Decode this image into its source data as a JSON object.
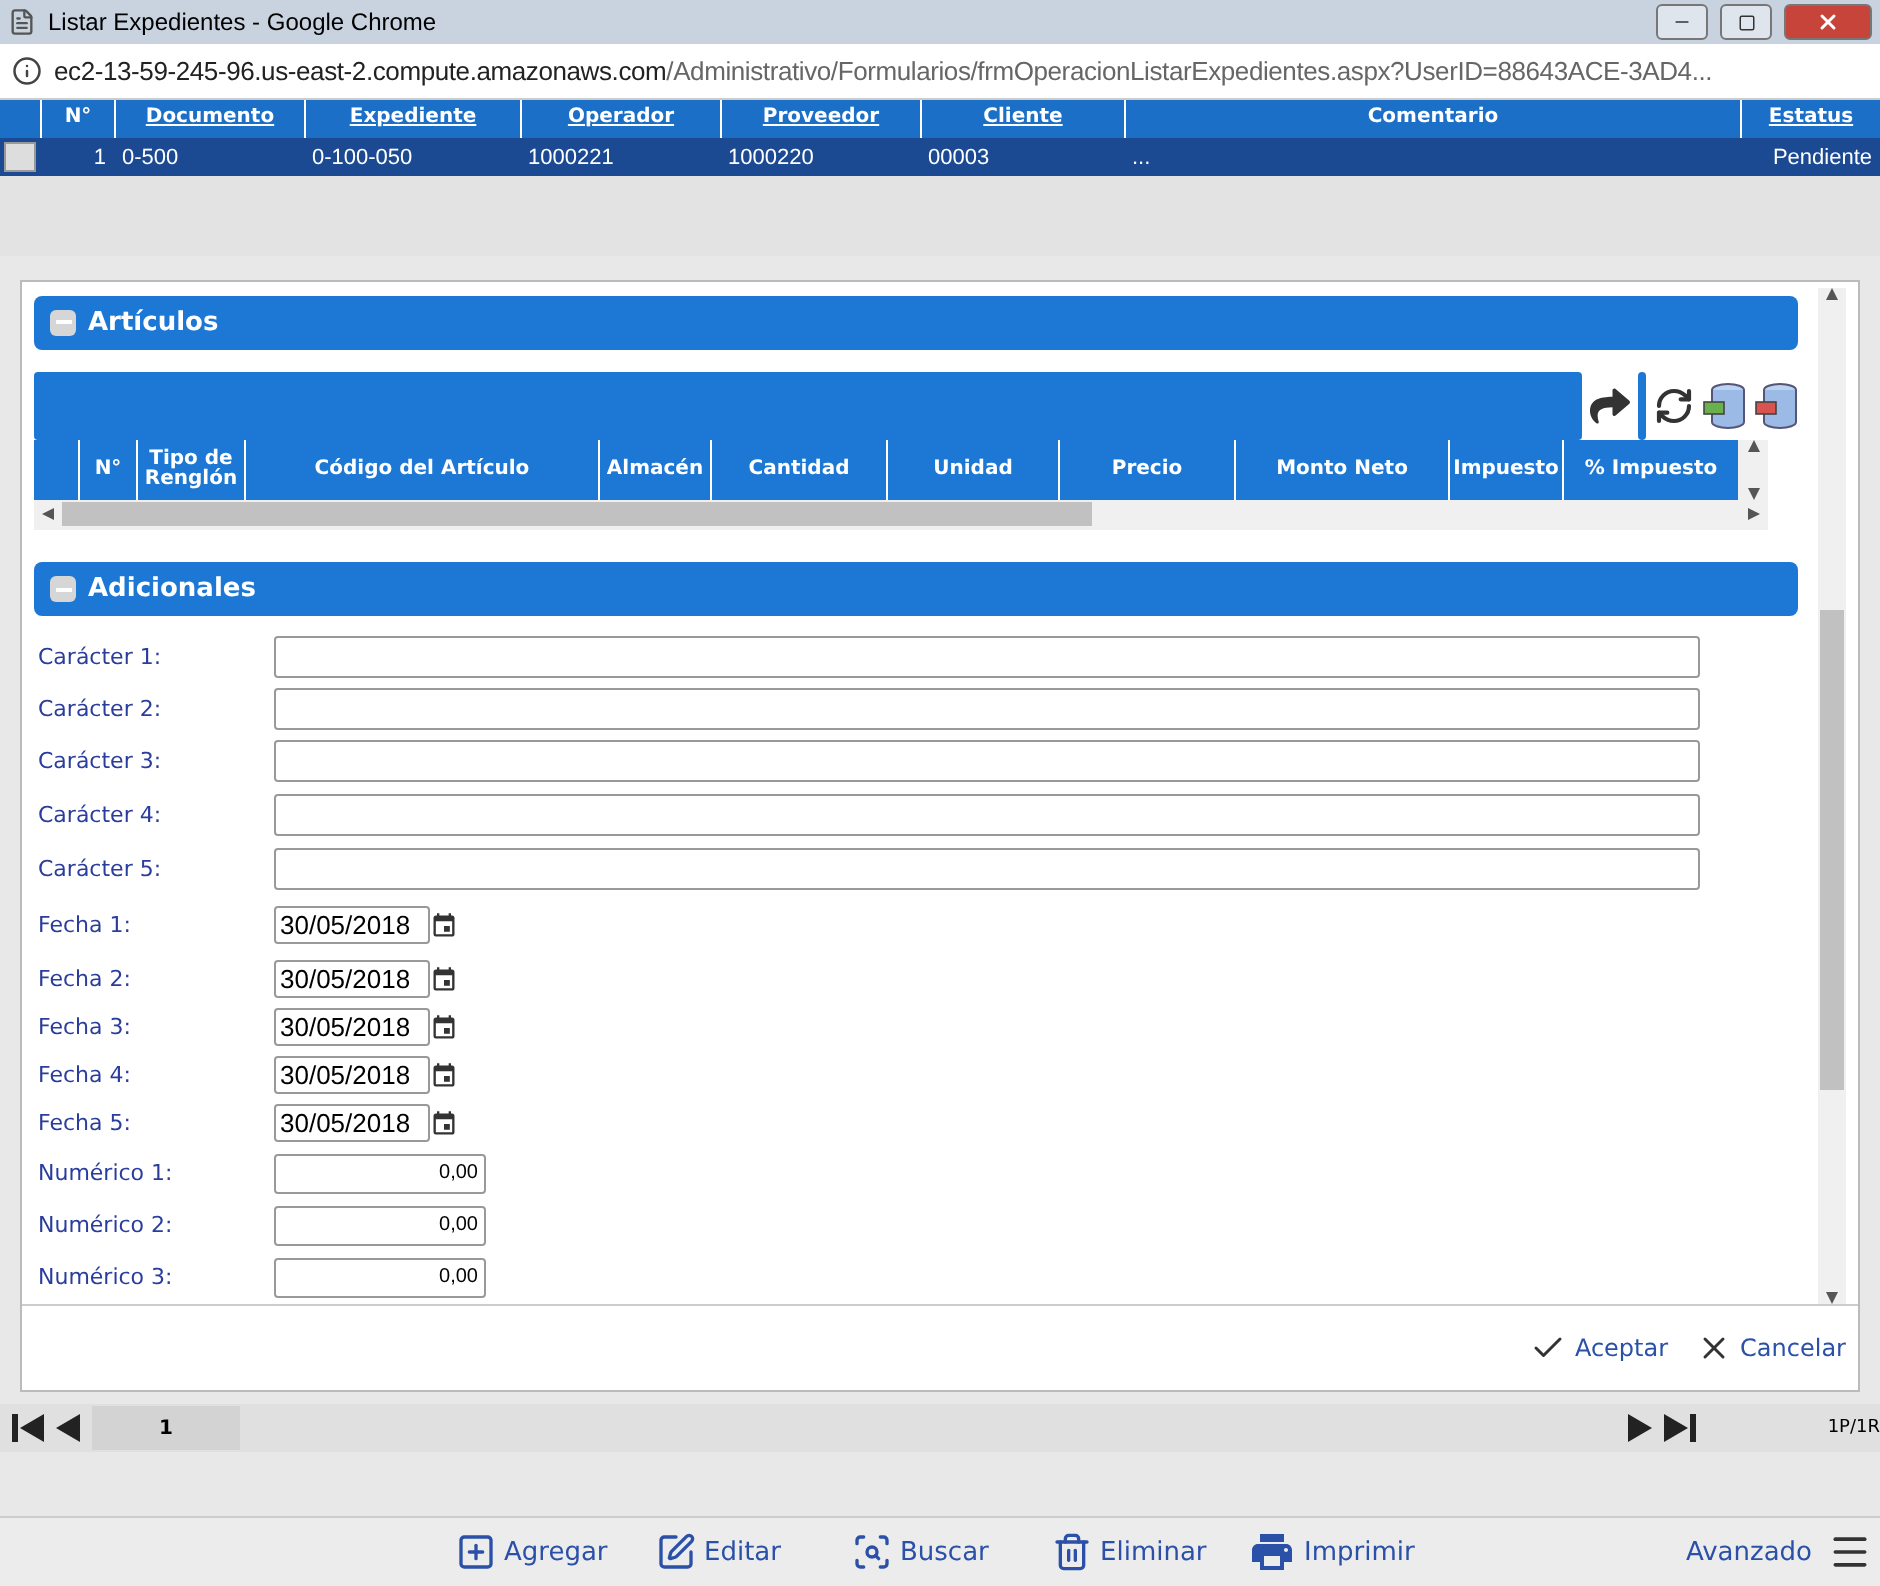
{
  "window": {
    "title": "Listar Expedientes - Google Chrome"
  },
  "address_bar": {
    "host": "ec2-13-59-245-96.us-east-2.compute.amazonaws.com",
    "path": "/Administrativo/Formularios/frmOperacionListarExpedientes.aspx?UserID=88643ACE-3AD4..."
  },
  "grid": {
    "columns": [
      {
        "label": "N°",
        "link": false
      },
      {
        "label": "Documento",
        "link": true
      },
      {
        "label": "Expediente",
        "link": true
      },
      {
        "label": "Operador",
        "link": true
      },
      {
        "label": "Proveedor",
        "link": true
      },
      {
        "label": "Cliente",
        "link": true
      },
      {
        "label": "Comentario",
        "link": false
      },
      {
        "label": "Estatus",
        "link": true
      }
    ],
    "rows": [
      {
        "selected": true,
        "cells": [
          "1",
          "0-500",
          "0-100-050",
          "1000221",
          "1000220",
          "00003",
          "...",
          "Pendiente"
        ]
      }
    ]
  },
  "articulos": {
    "title": "Artículos",
    "expanded": true,
    "columns": [
      "N°",
      "Tipo de Renglón",
      "Código del Artículo",
      "Almacén",
      "Cantidad",
      "Unidad",
      "Precio",
      "Monto Neto",
      "Impuesto",
      "% Impuesto"
    ]
  },
  "adicionales": {
    "title": "Adicionales",
    "expanded": true,
    "fields": [
      {
        "label": "Carácter 1:",
        "kind": "text"
      },
      {
        "label": "Carácter 2:",
        "kind": "text"
      },
      {
        "label": "Carácter 3:",
        "kind": "text"
      },
      {
        "label": "Carácter 4:",
        "kind": "text"
      },
      {
        "label": "Carácter 5:",
        "kind": "text"
      },
      {
        "label": "Fecha 1:",
        "kind": "date",
        "value": "30/05/2018"
      },
      {
        "label": "Fecha 2:",
        "kind": "date",
        "value": "30/05/2018"
      },
      {
        "label": "Fecha 3:",
        "kind": "date",
        "value": "30/05/2018"
      },
      {
        "label": "Fecha 4:",
        "kind": "date",
        "value": "30/05/2018"
      },
      {
        "label": "Fecha 5:",
        "kind": "date",
        "value": "30/05/2018"
      },
      {
        "label": "Numérico 1:",
        "kind": "number",
        "value": "0,00"
      },
      {
        "label": "Numérico 2:",
        "kind": "number",
        "value": "0,00"
      },
      {
        "label": "Numérico 3:",
        "kind": "number",
        "value": "0,00"
      }
    ]
  },
  "dialog_buttons": [
    {
      "label": "Aceptar",
      "kind": "accept"
    },
    {
      "label": "Cancelar",
      "kind": "cancel"
    }
  ],
  "pager": {
    "page": "1",
    "summary": "1P/1R"
  },
  "toolbar": [
    {
      "label": "Agregar",
      "kind": "add"
    },
    {
      "label": "Editar",
      "kind": "edit"
    },
    {
      "label": "Buscar",
      "kind": "search"
    },
    {
      "label": "Eliminar",
      "kind": "delete"
    },
    {
      "label": "Imprimir",
      "kind": "print"
    }
  ],
  "advanced": {
    "label": "Avanzado"
  }
}
